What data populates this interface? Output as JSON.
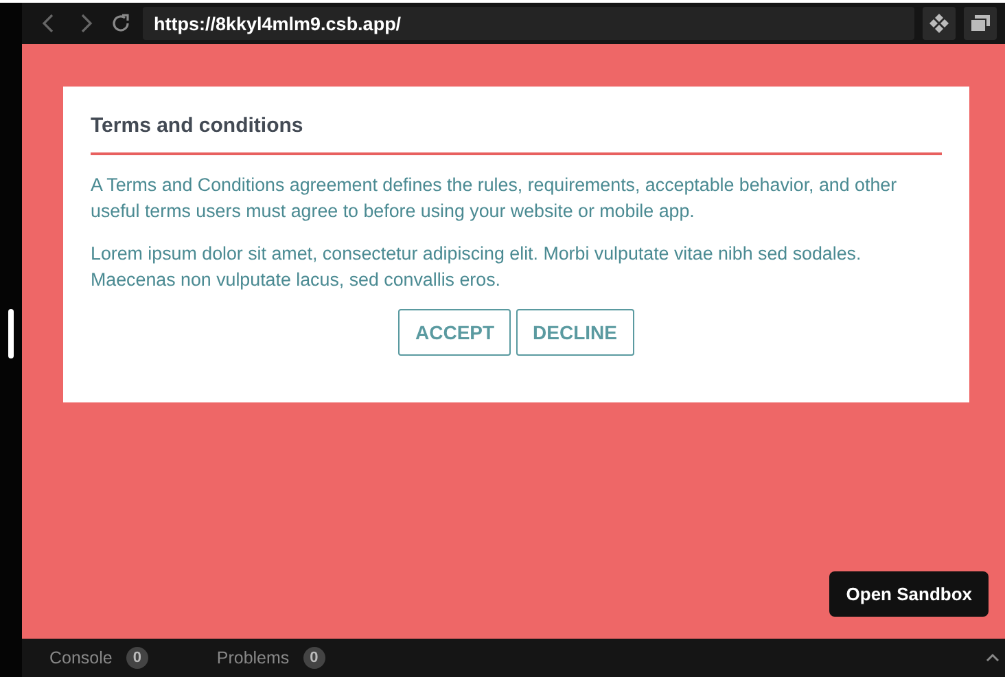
{
  "browser": {
    "url": "https://8kkyl4mlm9.csb.app/"
  },
  "dialog": {
    "title": "Terms and conditions",
    "paragraphs": [
      "A Terms and Conditions agreement defines the rules, requirements, acceptable behavior, and other useful terms users must agree to before using your website or mobile app.",
      "Lorem ipsum dolor sit amet, consectetur adipiscing elit. Morbi vulputate vitae nibh sed sodales. Maecenas non vulputate lacus, sed convallis eros."
    ],
    "buttons": [
      "ACCEPT",
      "DECLINE"
    ]
  },
  "open_sandbox": "Open Sandbox",
  "panel_tabs": [
    {
      "label": "Console",
      "count": "0"
    },
    {
      "label": "Problems",
      "count": "0"
    }
  ]
}
